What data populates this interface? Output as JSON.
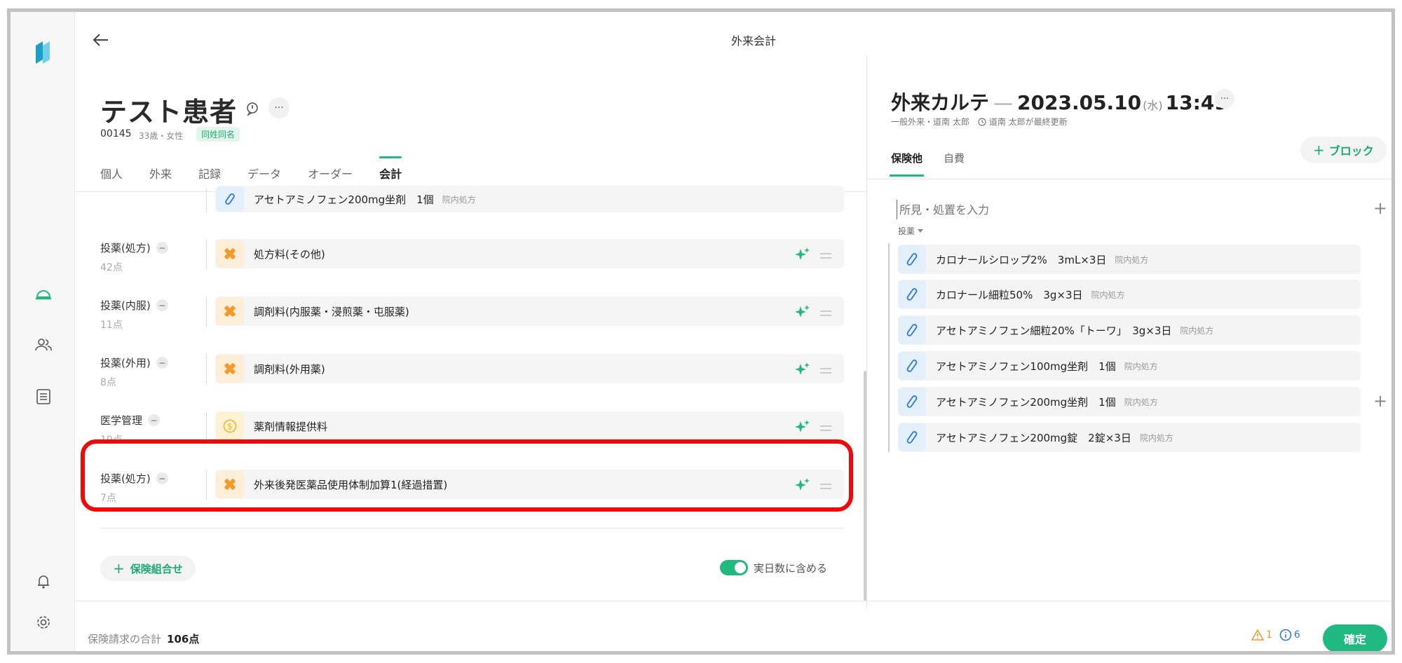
{
  "header": {
    "title": "外来会計"
  },
  "patient": {
    "name": "テスト患者",
    "id": "00145",
    "age_sex": "33歳・女性",
    "badge": "同姓同名",
    "more": "···"
  },
  "tabs_left": [
    "個人",
    "外来",
    "記録",
    "データ",
    "オーダー",
    "会計"
  ],
  "billing_rows": [
    {
      "label": "",
      "points": "",
      "item": "アセトアミノフェン200mg坐剤　1個",
      "sub": "院内処方",
      "icon": "pill-icon",
      "actions": false
    },
    {
      "label": "投薬(処方)",
      "points": "42点",
      "item": "処方料(その他)",
      "sub": "",
      "icon": "medical-cross-icon",
      "actions": true
    },
    {
      "label": "投薬(内服)",
      "points": "11点",
      "item": "調剤料(内服薬・浸煎薬・屯服薬)",
      "sub": "",
      "icon": "medical-cross-icon",
      "actions": true
    },
    {
      "label": "投薬(外用)",
      "points": "8点",
      "item": "調剤料(外用薬)",
      "sub": "",
      "icon": "medical-cross-icon",
      "actions": true
    },
    {
      "label": "医学管理",
      "points": "10点",
      "item": "薬剤情報提供料",
      "sub": "",
      "icon": "coin-icon",
      "actions": true
    },
    {
      "label": "投薬(処方)",
      "points": "7点",
      "item": "外来後発医薬品使用体制加算1(経過措置)",
      "sub": "",
      "icon": "medical-cross-icon",
      "actions": true
    }
  ],
  "left_footer": {
    "add_insurance": "保険組合せ",
    "toggle_label": "実日数に含める"
  },
  "karte": {
    "title": "外来カルテ",
    "date": "2023.05.10",
    "dow": "(水)",
    "time": "13:49",
    "sub_dept": "一般外来・道南 太郎",
    "sub_updated": "道南 太郎が最終更新",
    "more": "···"
  },
  "tabs_right": [
    "保険他",
    "自費"
  ],
  "block_button": "ブロック",
  "findings_placeholder": "所見・処置を入力",
  "section_label": "投薬",
  "prescriptions": [
    {
      "name": "カロナールシロップ2%　3mL×3日",
      "sub": "院内処方"
    },
    {
      "name": "カロナール細粒50%　3g×3日",
      "sub": "院内処方"
    },
    {
      "name": "アセトアミノフェン細粒20%「トーワ」　3g×3日",
      "sub": "院内処方"
    },
    {
      "name": "アセトアミノフェン100mg坐剤　1個",
      "sub": "院内処方"
    },
    {
      "name": "アセトアミノフェン200mg坐剤　1個",
      "sub": "院内処方"
    },
    {
      "name": "アセトアミノフェン200mg錠　2錠×3日",
      "sub": "院内処方"
    }
  ],
  "footer": {
    "total_label": "保険請求の合計",
    "total_value": "106点",
    "warn_count": "1",
    "info_count": "6",
    "confirm": "確定"
  },
  "colors": {
    "accent": "#1fb981",
    "highlight": "#ee0a0a",
    "orange": "#f39a2b",
    "blue": "#2b7bd6"
  }
}
